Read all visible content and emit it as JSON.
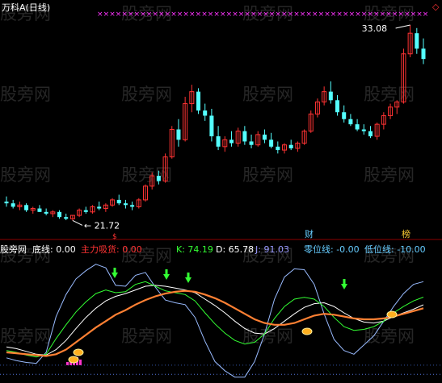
{
  "window_title": "万科A(日线)",
  "watermark": "股旁网",
  "top_right_marker": "◇",
  "price_panel": {
    "high_label": "33.08",
    "low_label": "21.72",
    "event_tags": [
      {
        "text": "财",
        "color": "#66ccff"
      },
      {
        "text": "榜",
        "color": "#ffcc33"
      }
    ],
    "candles_ohlc": [
      [
        22.8,
        23.1,
        22.5,
        22.7
      ],
      [
        22.7,
        22.9,
        22.4,
        22.5
      ],
      [
        22.5,
        22.8,
        22.3,
        22.6
      ],
      [
        22.6,
        22.7,
        22.2,
        22.3
      ],
      [
        22.3,
        22.5,
        22.1,
        22.4
      ],
      [
        22.4,
        22.6,
        22.2,
        22.2
      ],
      [
        22.2,
        22.4,
        22.0,
        22.1
      ],
      [
        22.1,
        22.3,
        21.9,
        22.2
      ],
      [
        22.2,
        22.3,
        21.8,
        21.9
      ],
      [
        21.9,
        22.1,
        21.72,
        21.8
      ],
      [
        21.8,
        22.0,
        21.7,
        22.0
      ],
      [
        22.0,
        22.4,
        21.9,
        22.3
      ],
      [
        22.3,
        22.5,
        22.1,
        22.2
      ],
      [
        22.2,
        22.6,
        22.1,
        22.5
      ],
      [
        22.5,
        22.8,
        22.3,
        22.4
      ],
      [
        22.4,
        22.7,
        22.2,
        22.6
      ],
      [
        22.6,
        23.0,
        22.5,
        22.9
      ],
      [
        22.9,
        23.2,
        22.6,
        22.7
      ],
      [
        22.7,
        22.9,
        22.4,
        22.6
      ],
      [
        22.6,
        22.8,
        22.3,
        22.5
      ],
      [
        22.5,
        23.0,
        22.4,
        22.9
      ],
      [
        22.9,
        23.8,
        22.8,
        23.7
      ],
      [
        23.7,
        24.5,
        23.5,
        24.3
      ],
      [
        24.3,
        24.6,
        23.8,
        24.0
      ],
      [
        24.0,
        25.6,
        23.9,
        25.4
      ],
      [
        25.4,
        27.2,
        25.3,
        27.0
      ],
      [
        27.0,
        27.6,
        26.0,
        26.4
      ],
      [
        26.4,
        28.9,
        26.3,
        28.5
      ],
      [
        28.5,
        29.6,
        28.0,
        29.2
      ],
      [
        29.2,
        29.4,
        27.9,
        28.1
      ],
      [
        28.1,
        28.5,
        27.5,
        27.8
      ],
      [
        27.8,
        28.2,
        26.3,
        26.6
      ],
      [
        26.6,
        27.2,
        25.8,
        26.0
      ],
      [
        26.0,
        26.6,
        25.7,
        26.4
      ],
      [
        26.4,
        26.9,
        26.0,
        26.2
      ],
      [
        26.2,
        27.1,
        26.0,
        26.9
      ],
      [
        26.9,
        27.2,
        26.1,
        26.3
      ],
      [
        26.3,
        26.7,
        25.9,
        26.1
      ],
      [
        26.1,
        26.9,
        26.0,
        26.7
      ],
      [
        26.7,
        27.0,
        26.2,
        26.4
      ],
      [
        26.4,
        26.8,
        25.9,
        26.0
      ],
      [
        26.0,
        26.3,
        25.6,
        25.8
      ],
      [
        25.8,
        26.2,
        25.6,
        26.1
      ],
      [
        26.1,
        26.4,
        25.8,
        25.9
      ],
      [
        25.9,
        26.3,
        25.7,
        26.2
      ],
      [
        26.2,
        27.0,
        26.1,
        26.9
      ],
      [
        26.9,
        28.1,
        26.8,
        27.9
      ],
      [
        27.9,
        28.8,
        27.7,
        28.6
      ],
      [
        28.6,
        29.5,
        28.4,
        29.2
      ],
      [
        29.2,
        29.8,
        28.5,
        28.7
      ],
      [
        28.7,
        29.0,
        27.8,
        28.0
      ],
      [
        28.0,
        28.4,
        27.4,
        27.6
      ],
      [
        27.6,
        27.9,
        27.2,
        27.3
      ],
      [
        27.3,
        27.6,
        26.9,
        27.0
      ],
      [
        27.0,
        27.3,
        26.7,
        26.9
      ],
      [
        26.9,
        27.2,
        26.5,
        26.6
      ],
      [
        26.6,
        27.4,
        26.4,
        27.3
      ],
      [
        27.3,
        28.0,
        27.0,
        27.8
      ],
      [
        27.8,
        28.5,
        27.6,
        28.3
      ],
      [
        28.3,
        28.7,
        27.9,
        28.6
      ],
      [
        28.6,
        31.7,
        28.5,
        31.4
      ],
      [
        31.4,
        33.08,
        31.2,
        32.6
      ],
      [
        32.6,
        32.9,
        31.4,
        31.7
      ],
      [
        31.7,
        32.3,
        30.8,
        31.1
      ]
    ],
    "axis_range": [
      21.3,
      33.5
    ]
  },
  "indicator_panel": {
    "label_source": "股旁网",
    "legend": [
      {
        "text": "底线: 0.00",
        "color": "#ffffff"
      },
      {
        "text": "主力吸货: 0.00",
        "color": "#ff3333"
      },
      {
        "text": "K: 74.19",
        "color": "#33ff33"
      },
      {
        "text": "D: 65.78",
        "color": "#ffffff"
      },
      {
        "text": "J: 91.03",
        "color": "#9999ff"
      },
      {
        "text": "零位线: -0.00",
        "color": "#66ccff"
      },
      {
        "text": "低位线: -10.00",
        "color": "#66ccff"
      }
    ],
    "axis_range": [
      -15,
      115
    ]
  },
  "chart_data": {
    "type": "line",
    "series": [
      {
        "name": "底线",
        "values": [
          0,
          0,
          0,
          0,
          0,
          0
        ]
      },
      {
        "name": "主力吸货",
        "values": [
          0,
          0,
          0,
          0,
          0,
          0
        ]
      },
      {
        "name": "K",
        "values": [
          16,
          14,
          11,
          9,
          12,
          29,
          44,
          58,
          69,
          78,
          82,
          79,
          80,
          88,
          91,
          86,
          81,
          79,
          77,
          70,
          57,
          45,
          35,
          27,
          23,
          25,
          34,
          51,
          64,
          72,
          74,
          72,
          64,
          52,
          42,
          38,
          39,
          42,
          48,
          57,
          64,
          70,
          74.19
        ]
      },
      {
        "name": "D",
        "values": [
          20,
          18,
          15,
          12,
          11,
          17,
          27,
          40,
          52,
          62,
          70,
          75,
          78,
          82,
          86,
          87,
          86,
          84,
          82,
          79,
          72,
          65,
          57,
          48,
          40,
          35,
          34,
          40,
          48,
          56,
          63,
          67,
          68,
          64,
          57,
          51,
          47,
          46,
          48,
          53,
          57,
          61,
          65.78
        ]
      },
      {
        "name": "J",
        "values": [
          8,
          5,
          3,
          2,
          14,
          53,
          77,
          94,
          103,
          110,
          106,
          87,
          86,
          98,
          101,
          85,
          71,
          68,
          66,
          52,
          26,
          4,
          -6,
          -13,
          -13,
          4,
          34,
          72,
          96,
          105,
          104,
          88,
          56,
          28,
          16,
          12,
          22,
          32,
          48,
          64,
          78,
          88,
          91.03
        ]
      },
      {
        "name": "零位线",
        "values": [
          0,
          0,
          0,
          0,
          0,
          0
        ]
      },
      {
        "name": "低位线",
        "values": [
          -10,
          -10,
          -10,
          -10,
          -10,
          -10
        ]
      }
    ],
    "slow_line": [
      14,
      13,
      12,
      11,
      10,
      12,
      17,
      25,
      33,
      41,
      48,
      55,
      60,
      66,
      71,
      75,
      78,
      80,
      81,
      80,
      77,
      73,
      68,
      62,
      56,
      50,
      46,
      44,
      44,
      46,
      50,
      54,
      56,
      55,
      53,
      51,
      50,
      50,
      51,
      53,
      56,
      59,
      62
    ],
    "ylim": [
      -15,
      115
    ]
  },
  "colors": {
    "up": "#ff3333",
    "down": "#54ffff",
    "marker_row": "#ff33ff",
    "k_line": "#33ff33",
    "d_line": "#ffffff",
    "j_line": "#99bbff",
    "slow_line": "#ff8033",
    "arrow": "#33ff33",
    "signal": "#ffb020"
  },
  "signals": {
    "green_arrows": [
      "a",
      "b",
      "c",
      "d"
    ],
    "gold_markers": [
      "a",
      "b",
      "c",
      "d"
    ]
  }
}
